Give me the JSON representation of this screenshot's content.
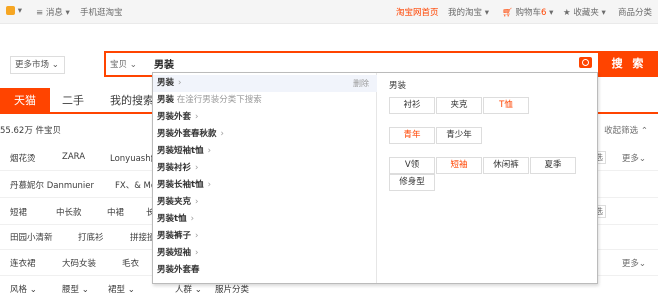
{
  "topbar": {
    "messages": "消息",
    "mobile": "手机逛淘宝",
    "home": "淘宝网首页",
    "my_taobao": "我的淘宝",
    "cart": "购物车",
    "cart_count": "6",
    "favorites": "收藏夹",
    "categories": "商品分类"
  },
  "header": {
    "market_button": "更多市场"
  },
  "search": {
    "category": "宝贝",
    "query": "男装",
    "button": "搜 索"
  },
  "tabs": [
    {
      "label": "天猫",
      "active": true
    },
    {
      "label": "二手",
      "active": false
    },
    {
      "label": "我的搜索",
      "active": false
    }
  ],
  "results": {
    "count": "55.62万 件宝贝",
    "collapse": "收起筛选",
    "more": "更多",
    "multi": "多选"
  },
  "rows": [
    [
      "烟花烫",
      "ZARA",
      "Lonyuash解"
    ],
    [
      "丹慕妮尔 Danmunier",
      "FX、& Mo"
    ],
    [
      "短裙",
      "中长款",
      "中裙",
      "长"
    ],
    [
      "田园小清新",
      "打底衫",
      "拼接撞"
    ],
    [
      "连衣裙",
      "大码女装",
      "毛衣"
    ],
    [
      "风格",
      "腰型",
      "裙型",
      "人群",
      "服片分类"
    ]
  ],
  "suggest": {
    "delete": "删除",
    "items": [
      {
        "bold": "男装",
        "rest": "",
        "hint": "",
        "arrow": true
      },
      {
        "bold": "男装",
        "rest": "",
        "hint": "在淦行男装分类下搜索",
        "arrow": false
      },
      {
        "bold": "男装外套",
        "rest": "",
        "hint": "",
        "arrow": true
      },
      {
        "bold": "男装外套春秋款",
        "rest": "",
        "hint": "",
        "arrow": true
      },
      {
        "bold": "男装短袖t恤",
        "rest": "",
        "hint": "",
        "arrow": true
      },
      {
        "bold": "男装衬衫",
        "rest": "",
        "hint": "",
        "arrow": true
      },
      {
        "bold": "男装长袖t恤",
        "rest": "",
        "hint": "",
        "arrow": true
      },
      {
        "bold": "男装夹克",
        "rest": "",
        "hint": "",
        "arrow": true
      },
      {
        "bold": "男装t恤",
        "rest": "",
        "hint": "",
        "arrow": true
      },
      {
        "bold": "男装裤子",
        "rest": "",
        "hint": "",
        "arrow": true
      },
      {
        "bold": "男装短袖",
        "rest": "",
        "hint": "",
        "arrow": true
      },
      {
        "bold": "男装外套春",
        "rest": "",
        "hint": "",
        "arrow": false
      }
    ],
    "right_title": "男装",
    "group1": [
      "衬衫",
      "夹克",
      "T恤"
    ],
    "group2": [
      "青年",
      "青少年"
    ],
    "group3": [
      "V领",
      "短袖",
      "休闲裤",
      "夏季",
      "修身型"
    ]
  },
  "colors": {
    "accent": "#ff4400"
  }
}
